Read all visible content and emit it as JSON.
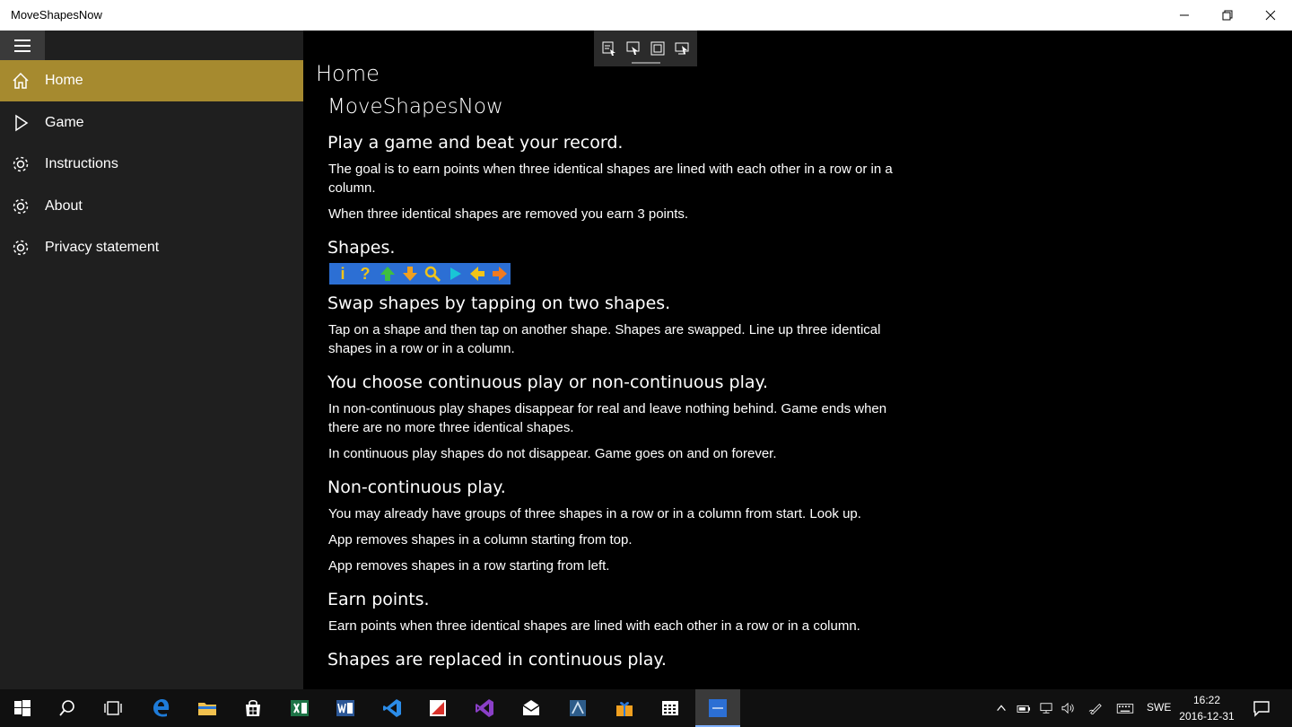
{
  "window": {
    "title": "MoveShapesNow",
    "minimize_icon": "minimize-icon",
    "restore_icon": "restore-icon",
    "close_icon": "close-icon"
  },
  "sidebar": {
    "accent": "#a68a2f",
    "items": [
      {
        "label": "Home",
        "icon": "home-icon",
        "active": true
      },
      {
        "label": "Game",
        "icon": "play-icon",
        "active": false
      },
      {
        "label": "Instructions",
        "icon": "gear-icon",
        "active": false
      },
      {
        "label": "About",
        "icon": "gear-icon",
        "active": false
      },
      {
        "label": "Privacy statement",
        "icon": "gear-icon",
        "active": false
      }
    ]
  },
  "toolbar": {
    "icons": [
      "select-element-icon",
      "pointer-icon",
      "frame-icon",
      "screen-pointer-icon"
    ]
  },
  "main": {
    "page_title": "Home",
    "app_name": "MoveShapesNow",
    "sections": [
      {
        "heading": "Play a game and beat your record.",
        "paragraphs": [
          "The goal is to earn points when three identical shapes are lined with each other in a row or in a column.",
          "When three identical shapes are removed you earn 3 points."
        ]
      },
      {
        "heading": "Shapes.",
        "shapes": [
          "info-icon",
          "question-icon",
          "arrow-up-icon",
          "arrow-down-icon",
          "magnifier-icon",
          "play-triangle-icon",
          "arrow-left-icon",
          "arrow-right-icon"
        ]
      },
      {
        "heading": "Swap shapes by tapping on two shapes.",
        "paragraphs": [
          "Tap on a shape and then tap on another shape. Shapes are swapped. Line up three identical shapes in a row or in a column."
        ]
      },
      {
        "heading": "You choose continuous play or non-continuous play.",
        "paragraphs": [
          "In non-continuous play shapes disappear for real and leave nothing behind. Game ends when there are no more three identical shapes.",
          "In continuous play shapes do not disappear. Game goes on and on forever."
        ]
      },
      {
        "heading": "Non-continuous play.",
        "paragraphs": [
          "You may already have groups of three shapes in a row or in a column from start. Look up.",
          "App removes shapes in a column starting from top.",
          "App removes shapes in a row starting from left."
        ]
      },
      {
        "heading": "Earn points.",
        "paragraphs": [
          "Earn points when three identical shapes are lined with each other in a row or in a column."
        ]
      },
      {
        "heading": "Shapes are replaced in continuous play."
      }
    ]
  },
  "taskbar": {
    "apps": [
      "start-icon",
      "search-icon",
      "task-view-icon",
      "edge-icon",
      "file-explorer-icon",
      "store-icon",
      "excel-icon",
      "word-icon",
      "visual-studio-code-icon",
      "paint-icon",
      "visual-studio-icon",
      "mail-icon",
      "app-icon",
      "gift-icon",
      "calculator-icon",
      "moveshapesnow-icon"
    ],
    "tray": {
      "language": "SWE",
      "time": "16:22",
      "date": "2016-12-31"
    }
  }
}
